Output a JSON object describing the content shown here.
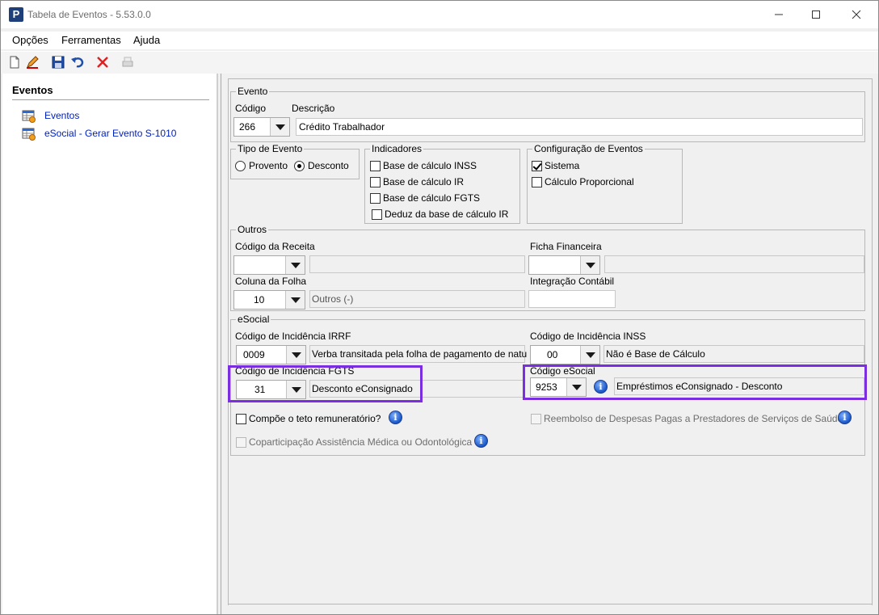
{
  "window": {
    "title": "Tabela de Eventos - 5.53.0.0",
    "app_icon": "P"
  },
  "menu": [
    "Opções",
    "Ferramentas",
    "Ajuda"
  ],
  "toolbar": [
    "new-icon",
    "edit-icon",
    "save-icon",
    "undo-icon",
    "delete-icon",
    "print-icon"
  ],
  "sidebar": {
    "title": "Eventos",
    "items": [
      {
        "label": "Eventos",
        "icon": "table-icon"
      },
      {
        "label": "eSocial - Gerar Evento S-1010",
        "icon": "table-icon"
      }
    ]
  },
  "evento": {
    "legend": "Evento",
    "codigo_label": "Código",
    "codigo_value": "266",
    "descricao_label": "Descrição",
    "descricao_value": "Crédito Trabalhador"
  },
  "tipo_evento": {
    "legend": "Tipo de Evento",
    "options": [
      "Provento",
      "Desconto"
    ],
    "selected": "Desconto"
  },
  "indicadores": {
    "legend": "Indicadores",
    "items": [
      {
        "label": "Base de cálculo INSS",
        "checked": false
      },
      {
        "label": "Base de cálculo IR",
        "checked": false
      },
      {
        "label": "Base de cálculo FGTS",
        "checked": false
      },
      {
        "label": "Deduz da base de cálculo IR",
        "checked": false
      }
    ]
  },
  "config": {
    "legend": "Configuração de Eventos",
    "items": [
      {
        "label": "Sistema",
        "checked": true
      },
      {
        "label": "Cálculo Proporcional",
        "checked": false
      }
    ]
  },
  "outros": {
    "legend": "Outros",
    "codigo_receita_label": "Código da Receita",
    "codigo_receita_value": "",
    "codigo_receita_desc": "",
    "ficha_label": "Ficha Financeira",
    "ficha_value": "",
    "ficha_desc": "",
    "coluna_label": "Coluna da Folha",
    "coluna_value": "10",
    "coluna_desc": "Outros (-)",
    "integracao_label": "Integração Contábil",
    "integracao_value": ""
  },
  "esocial": {
    "legend": "eSocial",
    "irrf_label": "Código de Incidência IRRF",
    "irrf_value": "0009",
    "irrf_desc": "Verba transitada pela folha de pagamento de natu",
    "inss_label": "Código de Incidência INSS",
    "inss_value": "00",
    "inss_desc": "Não é Base de Cálculo",
    "fgts_label": "Código de Incidência FGTS",
    "fgts_value": "31",
    "fgts_desc": "Desconto eConsignado",
    "codigo_label": "Código eSocial",
    "codigo_value": "9253",
    "codigo_desc": "Empréstimos eConsignado - Desconto",
    "teto_label": "Compõe o teto remuneratório?",
    "reembolso_label": "Reembolso de Despesas Pagas a Prestadores de Serviços de Saúde",
    "coparticipacao_label": "Coparticipação Assistência Médica ou Odontológica"
  },
  "colors": {
    "highlight": "#7b2ee0",
    "link": "#0020c0",
    "info": "#1a56c8"
  }
}
